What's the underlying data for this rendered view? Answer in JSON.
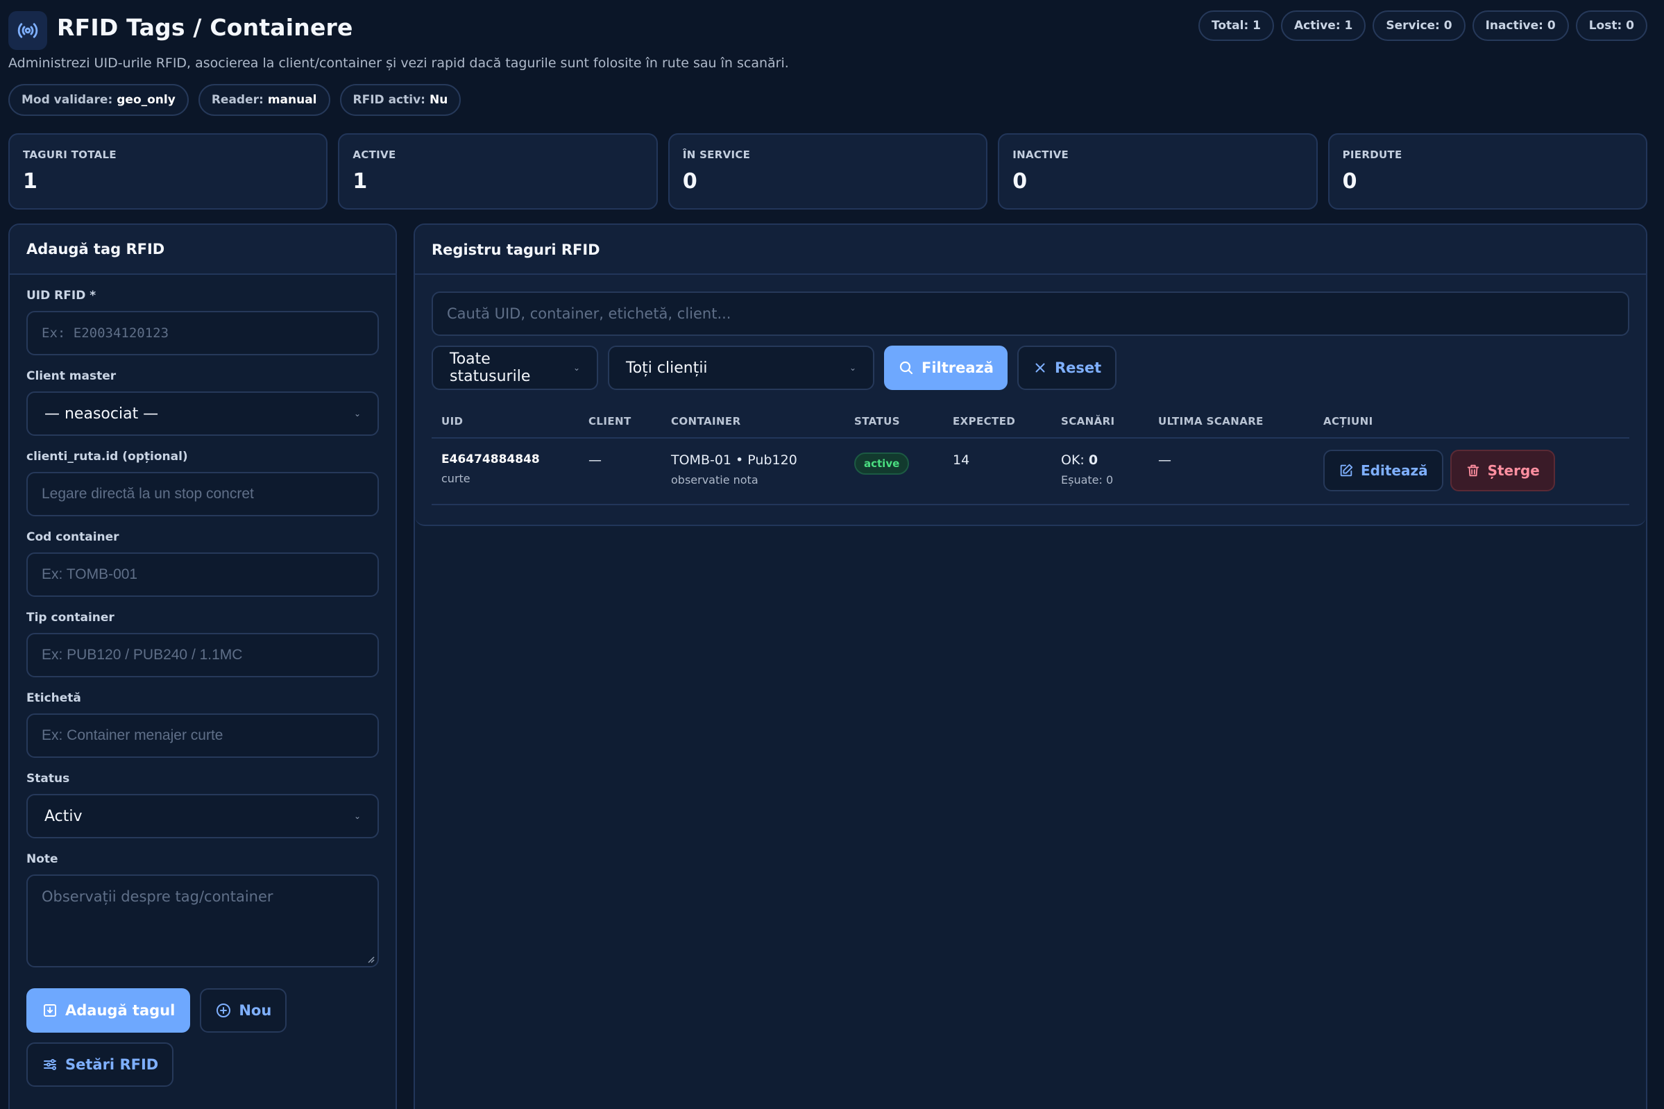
{
  "header": {
    "title": "RFID Tags / Containere",
    "subtitle": "Administrezi UID-urile RFID, asocierea la client/container și vezi rapid dacă tagurile sunt folosite în rute sau în scanări.",
    "icon": "broadcast-icon",
    "counters": [
      "Total: 1",
      "Active: 1",
      "Service: 0",
      "Inactive: 0",
      "Lost: 0"
    ],
    "modes": [
      {
        "label": "Mod validare:",
        "value": "geo_only"
      },
      {
        "label": "Reader:",
        "value": "manual"
      },
      {
        "label": "RFID activ:",
        "value": "Nu"
      }
    ]
  },
  "stats": [
    {
      "label": "TAGURI TOTALE",
      "value": "1"
    },
    {
      "label": "ACTIVE",
      "value": "1"
    },
    {
      "label": "ÎN SERVICE",
      "value": "0"
    },
    {
      "label": "INACTIVE",
      "value": "0"
    },
    {
      "label": "PIERDUTE",
      "value": "0"
    }
  ],
  "form": {
    "title": "Adaugă tag RFID",
    "uid_label": "UID RFID *",
    "uid_placeholder": "Ex: E20034120123",
    "client_label": "Client master",
    "client_value": "— neasociat —",
    "ruta_label": "clienti_ruta.id (opțional)",
    "ruta_placeholder": "Legare directă la un stop concret",
    "cod_label": "Cod container",
    "cod_placeholder": "Ex: TOMB-001",
    "tip_label": "Tip container",
    "tip_placeholder": "Ex: PUB120 / PUB240 / 1.1MC",
    "eticheta_label": "Etichetă",
    "eticheta_placeholder": "Ex: Container menajer curte",
    "status_label": "Status",
    "status_value": "Activ",
    "note_label": "Note",
    "note_placeholder": "Observații despre tag/container",
    "add_button": "Adaugă tagul",
    "new_button": "Nou",
    "settings_button": "Setări RFID"
  },
  "registry": {
    "title": "Registru taguri RFID",
    "search_placeholder": "Caută UID, container, etichetă, client...",
    "status_filter": "Toate statusurile",
    "client_filter": "Toți clienții",
    "filter_button": "Filtrează",
    "reset_button": "Reset",
    "columns": [
      "UID",
      "CLIENT",
      "CONTAINER",
      "STATUS",
      "EXPECTED",
      "SCANĂRI",
      "ULTIMA SCANARE",
      "ACȚIUNI"
    ],
    "rows": [
      {
        "uid": "E46474884848",
        "uid_sub": "curte",
        "client": "—",
        "container": "TOMB-01 • Pub120",
        "container_sub": "observatie nota",
        "status": "active",
        "expected": "14",
        "scan_ok_label": "OK:",
        "scan_ok": "0",
        "scan_fail": "Eșuate: 0",
        "last_scan": "—",
        "edit_label": "Editează",
        "delete_label": "Șterge"
      }
    ]
  },
  "colors": {
    "background": "#0b1628",
    "accent": "#6ea8fe",
    "success": "#4ade80",
    "danger": "#ff8fa0"
  }
}
